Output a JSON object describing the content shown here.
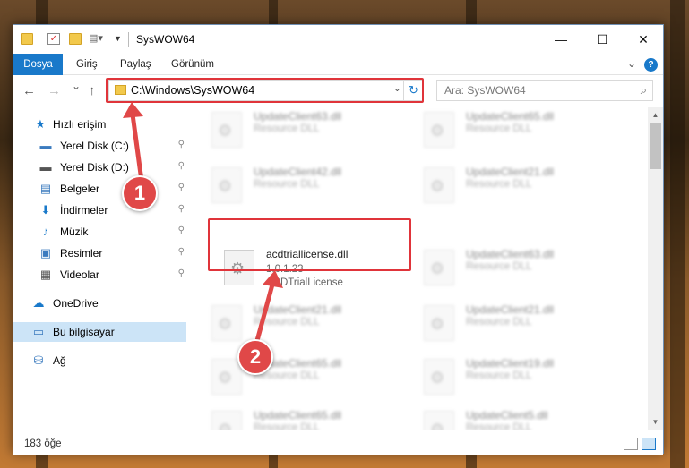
{
  "window": {
    "title": "SysWOW64",
    "controls": {
      "minimize": "—",
      "maximize": "☐",
      "close": "✕"
    }
  },
  "ribbon": {
    "file_tab": "Dosya",
    "tabs": [
      "Giriş",
      "Paylaş",
      "Görünüm"
    ],
    "expand_icon": "chevron-down-icon",
    "help_label": "?"
  },
  "navigation": {
    "back": "←",
    "forward": "→",
    "recent": "⌄",
    "up": "↑",
    "address": "C:\\Windows\\SysWOW64",
    "search_placeholder": "Ara: SysWOW64"
  },
  "sidebar": {
    "items": [
      {
        "label": "Hızlı erişim",
        "icon": "star-icon",
        "glyph": "★",
        "color": "#1979ca"
      },
      {
        "label": "Yerel Disk (C:)",
        "icon": "drive-icon",
        "glyph": "▬",
        "color": "#3b7bbf"
      },
      {
        "label": "Yerel Disk (D:)",
        "icon": "drive-icon",
        "glyph": "▬",
        "color": "#555555"
      },
      {
        "label": "Belgeler",
        "icon": "document-icon",
        "glyph": "▤",
        "color": "#3b7bbf"
      },
      {
        "label": "İndirmeler",
        "icon": "download-icon",
        "glyph": "⬇",
        "color": "#1979ca"
      },
      {
        "label": "Müzik",
        "icon": "music-icon",
        "glyph": "♪",
        "color": "#1979ca"
      },
      {
        "label": "Resimler",
        "icon": "pictures-icon",
        "glyph": "▣",
        "color": "#3b7bbf"
      },
      {
        "label": "Videolar",
        "icon": "video-icon",
        "glyph": "▦",
        "color": "#555555"
      },
      {
        "label": "OneDrive",
        "icon": "cloud-icon",
        "glyph": "☁",
        "color": "#1979ca"
      },
      {
        "label": "Bu bilgisayar",
        "icon": "computer-icon",
        "glyph": "▭",
        "color": "#3b7bbf"
      },
      {
        "label": "Ağ",
        "icon": "network-icon",
        "glyph": "⛁",
        "color": "#3b7bbf"
      }
    ],
    "pin_glyph": "📌"
  },
  "files": {
    "highlighted": {
      "name": "acdtriallicense.dll",
      "version": "1.0.1.23",
      "description": "ACDTrialLicense"
    },
    "blurred": [
      {
        "name": "UpdateClient63.dll",
        "desc": "Resource DLL"
      },
      {
        "name": "UpdateClient65.dll",
        "desc": "Resource DLL"
      },
      {
        "name": "UpdateClient42.dll",
        "desc": "Resource DLL"
      },
      {
        "name": "UpdateClient21.dll",
        "desc": "Resource DLL"
      },
      {
        "name": "UpdateClient63.dll",
        "desc": "Resource DLL"
      },
      {
        "name": "UpdateClient21.dll",
        "desc": "Resource DLL"
      },
      {
        "name": "UpdateClient21.dll",
        "desc": "Resource DLL"
      },
      {
        "name": "UpdateClient65.dll",
        "desc": "Resource DLL"
      },
      {
        "name": "UpdateClient19.dll",
        "desc": "Resource DLL"
      },
      {
        "name": "UpdateClient65.dll",
        "desc": "Resource DLL"
      },
      {
        "name": "UpdateClient5.dll",
        "desc": "Resource DLL"
      }
    ]
  },
  "status": {
    "count": "183 öğe"
  },
  "annotations": {
    "step1": "1",
    "step2": "2",
    "color": "#e04848"
  }
}
